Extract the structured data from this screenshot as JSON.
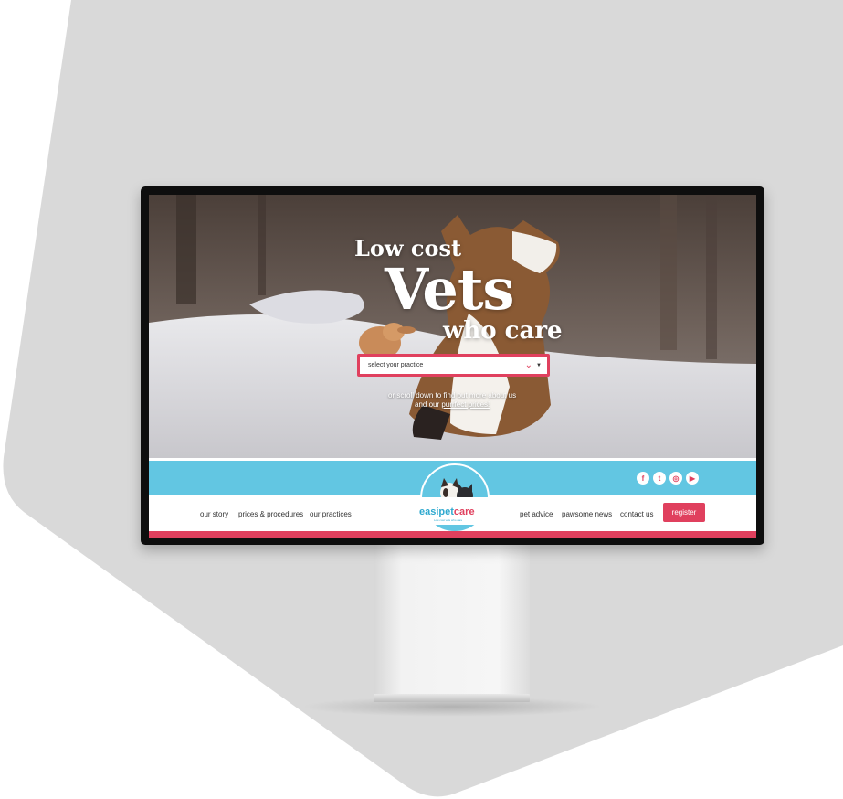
{
  "hero": {
    "line1": "Low cost",
    "line2": "Vets",
    "line3": "who care",
    "practice_select": {
      "placeholder": "select your practice"
    },
    "scroll_text_1": "or scroll down to find out more about us",
    "scroll_text_2_prefix": "and our ",
    "scroll_text_2_link": "purrfect prices!"
  },
  "socials": [
    {
      "icon": "facebook-icon",
      "glyph": "f"
    },
    {
      "icon": "twitter-icon",
      "glyph": "t"
    },
    {
      "icon": "instagram-icon",
      "glyph": "◎"
    },
    {
      "icon": "youtube-icon",
      "glyph": "▶"
    }
  ],
  "nav": {
    "left": [
      "our story",
      "prices & procedures",
      "our practices"
    ],
    "right": [
      "pet advice",
      "pawsome news",
      "contact us"
    ],
    "register_label": "register"
  },
  "logo": {
    "part1": "easipet",
    "part2": "care",
    "tagline": "Low cost vets who care"
  },
  "colors": {
    "brand_pink": "#e0405e",
    "brand_blue": "#62c6e2",
    "background_shape": "#d9d9d9"
  }
}
